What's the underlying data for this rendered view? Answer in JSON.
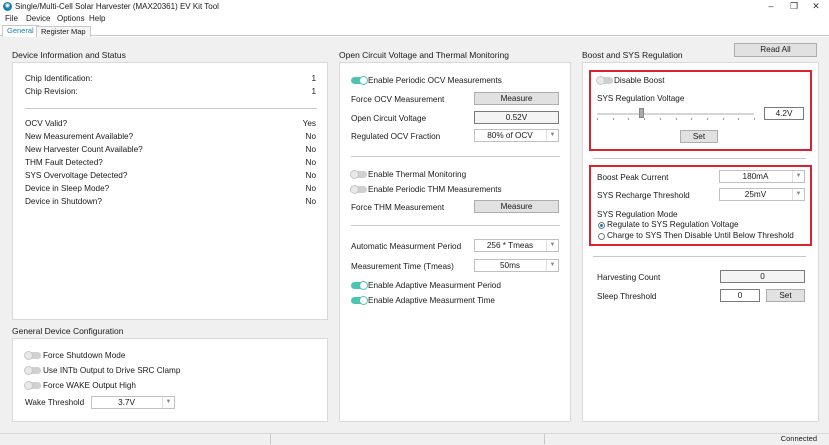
{
  "window": {
    "title": "Single/Multi-Cell Solar Harvester (MAX20361) EV Kit Tool",
    "minimize": "–",
    "maximize": "❐",
    "close": "✕"
  },
  "menu": {
    "items": [
      "File",
      "Device",
      "Options",
      "Help"
    ]
  },
  "tabs": [
    "General",
    "Register Map"
  ],
  "device_info": {
    "title": "Device Information and Status",
    "rows": [
      {
        "label": "Chip Identification:",
        "value": "1"
      },
      {
        "label": "Chip Revision:",
        "value": "1"
      }
    ],
    "status_rows": [
      {
        "label": "OCV Valid?",
        "value": "Yes"
      },
      {
        "label": "New  Measurement Available?",
        "value": "No"
      },
      {
        "label": "New Harvester Count Available?",
        "value": "No"
      },
      {
        "label": "THM Fault Detected?",
        "value": "No"
      },
      {
        "label": "SYS Overvoltage Detected?",
        "value": "No"
      },
      {
        "label": "Device in Sleep Mode?",
        "value": "No"
      },
      {
        "label": "Device in Shutdown?",
        "value": "No"
      }
    ]
  },
  "general_config": {
    "title": "General Device Configuration",
    "toggles": [
      "Force Shutdown Mode",
      "Use INTb Output to Drive SRC Clamp",
      "Force WAKE Output High"
    ],
    "wake_label": "Wake Threshold",
    "wake_value": "3.7V"
  },
  "ocv": {
    "title": "Open Circuit Voltage and Thermal Monitoring",
    "periodic_ocv": "Enable Periodic OCV Measurements",
    "force_ocv": "Force OCV Measurement",
    "measure_label": "Measure",
    "ocv_label": "Open Circuit Voltage",
    "ocv_value": "0.52V",
    "fraction_label": "Regulated OCV Fraction",
    "fraction_value": "80% of OCV",
    "thermal": "Enable Thermal Monitoring",
    "periodic_thm": "Enable Periodic THM Measurements",
    "force_thm": "Force THM Measurement",
    "auto_period_label": "Automatic Measurment Period",
    "auto_period_value": "256 * Tmeas",
    "tmeas_label": "Measurement Time (Tmeas)",
    "tmeas_value": "50ms",
    "adaptive_period": "Enable Adaptive Measurment Period",
    "adaptive_time": "Enable Adaptive Measurment Time"
  },
  "boost": {
    "title": "Boost and SYS Regulation",
    "read_all": "Read All",
    "disable_boost": "Disable Boost",
    "sys_reg_label": "SYS Regulation Voltage",
    "sys_reg_value": "4.2V",
    "slider_fraction": 0.28,
    "set_label": "Set",
    "peak_label": "Boost Peak Current",
    "peak_value": "180mA",
    "recharge_label": "SYS Recharge Threshold",
    "recharge_value": "25mV",
    "mode_label": "SYS Regulation Mode",
    "mode_options": [
      "Regulate to SYS Regulation Voltage",
      "Charge to SYS Then Disable Until Below Threshold"
    ],
    "harvest_label": "Harvesting Count",
    "harvest_value": "0",
    "sleep_label": "Sleep Threshold",
    "sleep_value": "0"
  },
  "status": {
    "text": "Connected"
  },
  "colors": {
    "accent": "#1a7fb5",
    "toggle_on": "#4ec3b4",
    "highlight": "#d9232e"
  }
}
